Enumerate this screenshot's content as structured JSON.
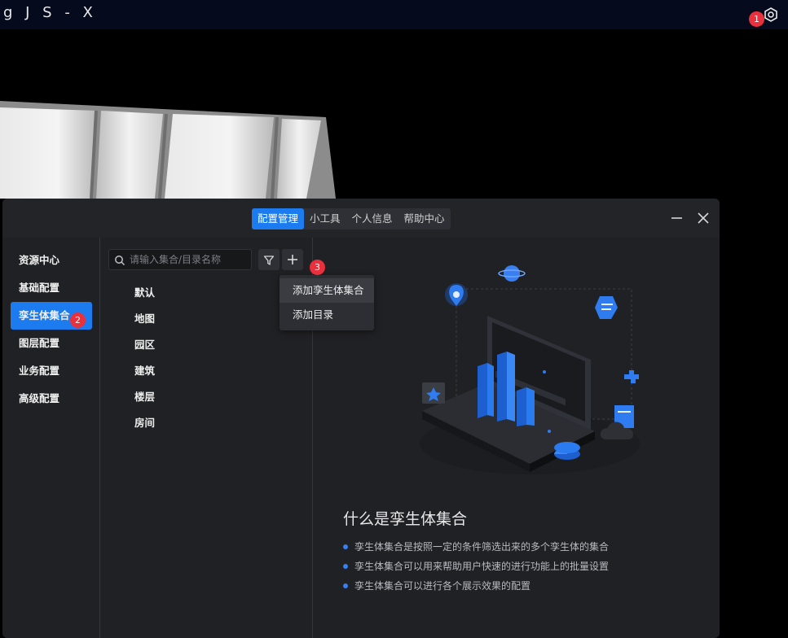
{
  "app": {
    "title": "g J S - X"
  },
  "annotations": {
    "badge1": "1",
    "badge2": "2",
    "badge3": "3"
  },
  "icons": {
    "settings": "gear-icon",
    "search": "search-icon",
    "filter": "filter-icon",
    "add": "plus-icon",
    "minimize": "minimize-icon",
    "close": "close-icon"
  },
  "panel": {
    "tabs": [
      {
        "label": "配置管理",
        "active": true
      },
      {
        "label": "小工具",
        "active": false
      },
      {
        "label": "个人信息",
        "active": false
      },
      {
        "label": "帮助中心",
        "active": false
      }
    ]
  },
  "sidebar": {
    "items": [
      {
        "label": "资源中心",
        "active": false
      },
      {
        "label": "基础配置",
        "active": false
      },
      {
        "label": "孪生体集合",
        "active": true
      },
      {
        "label": "图层配置",
        "active": false
      },
      {
        "label": "业务配置",
        "active": false
      },
      {
        "label": "高级配置",
        "active": false
      }
    ]
  },
  "search": {
    "placeholder": "请输入集合/目录名称",
    "value": ""
  },
  "tree": {
    "items": [
      "默认",
      "地图",
      "园区",
      "建筑",
      "楼层",
      "房间"
    ]
  },
  "dropdown": {
    "items": [
      "添加孪生体集合",
      "添加目录"
    ]
  },
  "info": {
    "title": "什么是孪生体集合",
    "bullets": [
      "孪生体集合是按照一定的条件筛选出来的多个孪生体的集合",
      "孪生体集合可以用来帮助用户快速的进行功能上的批量设置",
      "孪生体集合可以进行各个展示效果的配置"
    ]
  },
  "colors": {
    "accent": "#1d7bf0",
    "badge": "#e8313c",
    "panel_bg": "#202124",
    "topbar_bg": "#050a1c"
  }
}
